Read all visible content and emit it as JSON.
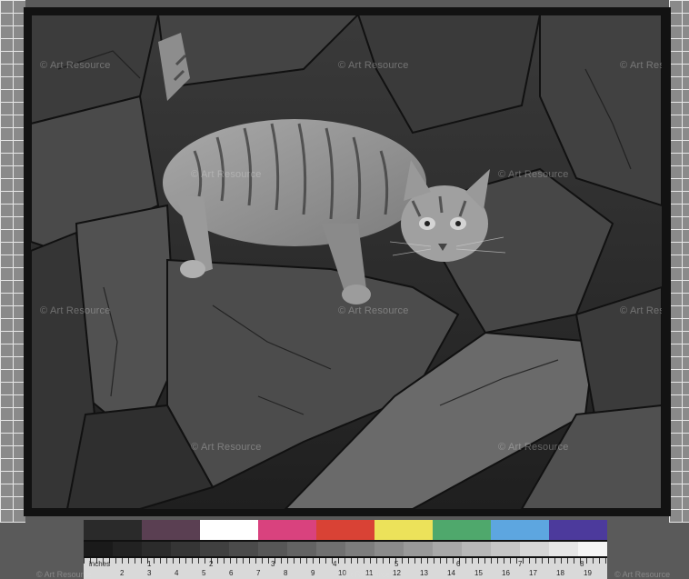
{
  "watermarks": [
    "© Art Resource",
    "© Art Resource",
    "© Art Resource",
    "© Art Resource",
    "© Art Resource",
    "© Art Resource",
    "© Art Resource",
    "© Art Resource",
    "© Art Resource",
    "© Art Resource",
    "© Art Resource",
    "© Art Resource",
    "© Art Resource"
  ],
  "color_chart": {
    "swatch_colors": [
      "#2a2a2a",
      "#5a3f52",
      "#ffffff",
      "#d9427e",
      "#d94235",
      "#ece25a",
      "#4fa86c",
      "#5da6e0",
      "#4c3a9c"
    ],
    "gray_steps": [
      "#1a1a1a",
      "#222",
      "#2b2b2b",
      "#353535",
      "#404040",
      "#4b4b4b",
      "#575757",
      "#636363",
      "#707070",
      "#7d7d7d",
      "#8b8b8b",
      "#999",
      "#a8a8a8",
      "#b7b7b7",
      "#c6c6c6",
      "#d6d6d6",
      "#e6e6e6",
      "#f5f5f5"
    ]
  },
  "ruler": {
    "unit_label": "inches",
    "inch_marks": [
      "1",
      "2",
      "3",
      "4",
      "5",
      "6",
      "7",
      "8"
    ],
    "cm_marks": [
      "2",
      "3",
      "4",
      "5",
      "6",
      "7",
      "8",
      "9",
      "10",
      "11",
      "12",
      "13",
      "14",
      "15",
      "16",
      "17",
      "18",
      "19"
    ]
  }
}
